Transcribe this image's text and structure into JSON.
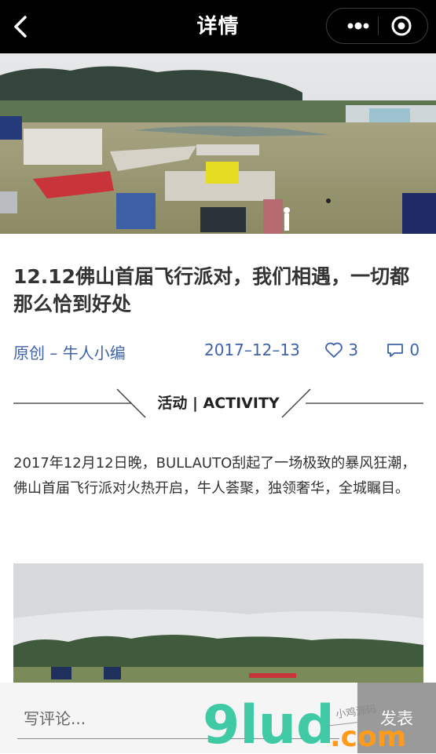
{
  "nav": {
    "title": "详情",
    "icons": {
      "back": "chevron-left-icon",
      "more": "more-dots-icon",
      "close": "target-circle-icon"
    }
  },
  "article": {
    "headline": "12.12佛山首届飞行派对，我们相遇，一切都那么恰到好处",
    "author": "原创 – 牛人小编",
    "date": "2017–12–13",
    "likes": "3",
    "comments": "0",
    "section_label": "活动 | ACTIVITY",
    "paragraph": "2017年12月12日晚，BULLAUTO刮起了一场极致的暴风狂潮，佛山首届飞行派对火热开启，牛人荟聚，独领奢华，全城瞩目。"
  },
  "comment_bar": {
    "placeholder": "写评论...",
    "send_label": "发表"
  },
  "watermark": {
    "text": "9lud.com",
    "small": "小鸡源码"
  },
  "colors": {
    "accent": "#3f62a9",
    "watermark_green": "#3fc9a4",
    "watermark_orange": "#ff9b1a"
  }
}
